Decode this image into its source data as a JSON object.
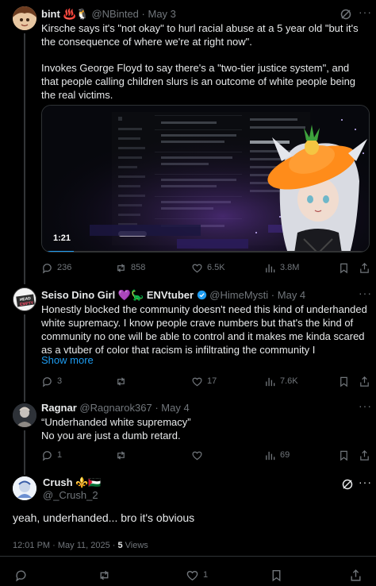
{
  "post1": {
    "name": "bint",
    "name_emoji": "♨️🐧",
    "handle": "@NBinted",
    "date": "May 3",
    "text_p1": "Kirsche says it's \"not okay\" to hurl racial abuse at a 5 year old \"but it's the consequence of where we're at right now\".",
    "text_p2": "Invokes George Floyd to say there's a \"two-tier justice system\", and that people calling children slurs is an outcome of white people being the real victims.",
    "video": {
      "duration": "1:21"
    },
    "stats": {
      "replies": "236",
      "reposts": "858",
      "likes": "6.5K",
      "views": "3.8M"
    }
  },
  "post2": {
    "name": "Seiso Dino Girl",
    "name_emoji": "💜🦕",
    "name_suffix": "ENVtuber",
    "handle": "@HimeMysti",
    "date": "May 4",
    "text": "Honestly blocked the community doesn't need this kind of underhanded white supremacy. I know people crave numbers but that's the kind of community no one will be able to control and it makes me kinda scared as a vtuber of color that racism is infiltrating the community I",
    "show_more": "Show more",
    "avatar_text": "HEAD EMPTY",
    "stats": {
      "replies": "3",
      "reposts": "",
      "likes": "17",
      "views": "7.6K"
    }
  },
  "post3": {
    "name": "Ragnar",
    "handle": "@Ragnarok367",
    "date": "May 4",
    "text_l1": "“Underhanded white supremacy”",
    "text_l2": "No you are just a dumb retard.",
    "stats": {
      "replies": "1",
      "reposts": "",
      "likes": "",
      "views": "69"
    }
  },
  "post4": {
    "name": "Crush",
    "name_emoji": "⚜️🇵🇸",
    "handle": "@_Crush_2",
    "text": "yeah, underhanded... bro it's obvious",
    "timestamp": "12:01 PM · May 11, 2025 · ",
    "views_count": "5",
    "views_label": " Views",
    "stats": {
      "replies": "",
      "reposts": "",
      "likes": "1",
      "bookmarks": ""
    }
  },
  "colors": {
    "accent": "#1d9bf0",
    "muted": "#71767b",
    "text": "#e7e9ea",
    "divider": "#2f3336"
  }
}
